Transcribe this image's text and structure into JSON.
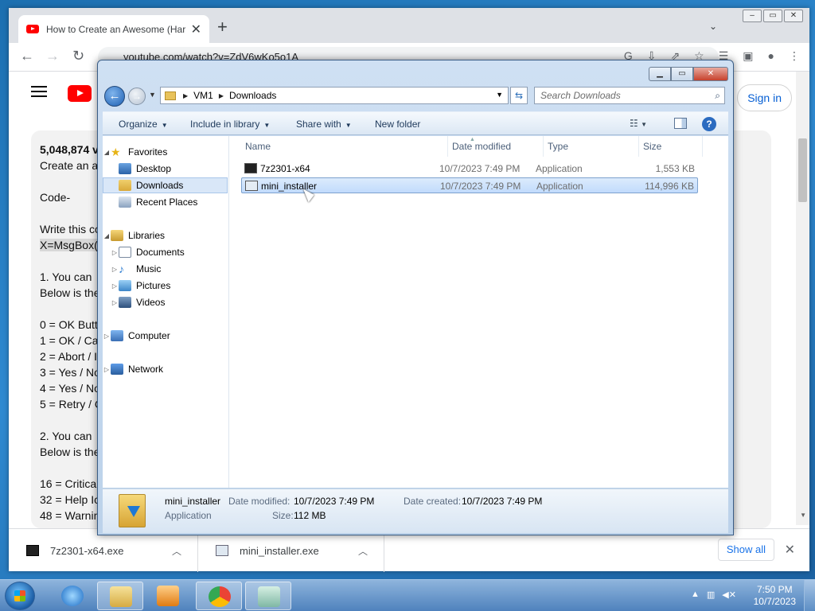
{
  "browser": {
    "tab_title": "How to Create an Awesome (Har",
    "address": "youtube.com/watch?v=ZdV6wKo5o1A",
    "signin_label": "Sign in",
    "new_tab": "+",
    "tab_close": "✕"
  },
  "description": {
    "views": "5,048,874 v",
    "lines": [
      "Create an a",
      "",
      "Code-",
      "",
      "Write this co",
      "X=MsgBox(",
      "",
      "1.  You can",
      "Below is the",
      "",
      "0 = OK Butto",
      "1 = OK / Ca",
      "2 = Abort / I",
      "3 = Yes / No",
      "4 = Yes / No",
      "5 = Retry / C",
      "",
      "2.  You can",
      "Below is the",
      "",
      "16 = Critica",
      "32 = Help Ic",
      "48 = Warnin"
    ]
  },
  "downloads_bar": {
    "items": [
      {
        "name": "7z2301-x64.exe"
      },
      {
        "name": "mini_installer.exe"
      }
    ],
    "show_all": "Show all"
  },
  "explorer": {
    "breadcrumb": [
      "VM1",
      "Downloads"
    ],
    "search_placeholder": "Search Downloads",
    "commands": {
      "organize": "Organize",
      "include_in_library": "Include in library",
      "share_with": "Share with",
      "new_folder": "New folder"
    },
    "nav": {
      "favorites": "Favorites",
      "desktop": "Desktop",
      "downloads": "Downloads",
      "recent_places": "Recent Places",
      "libraries": "Libraries",
      "documents": "Documents",
      "music": "Music",
      "pictures": "Pictures",
      "videos": "Videos",
      "computer": "Computer",
      "network": "Network"
    },
    "columns": {
      "name": "Name",
      "date_modified": "Date modified",
      "type": "Type",
      "size": "Size"
    },
    "files": [
      {
        "name": "7z2301-x64",
        "date": "10/7/2023 7:49 PM",
        "type": "Application",
        "size": "1,553 KB"
      },
      {
        "name": "mini_installer",
        "date": "10/7/2023 7:49 PM",
        "type": "Application",
        "size": "114,996 KB"
      }
    ],
    "details": {
      "name": "mini_installer",
      "type": "Application",
      "date_modified_label": "Date modified:",
      "date_modified": "10/7/2023 7:49 PM",
      "date_created_label": "Date created:",
      "date_created": "10/7/2023 7:49 PM",
      "size_label": "Size:",
      "size": "112 MB"
    }
  },
  "taskbar": {
    "time": "7:50 PM",
    "date": "10/7/2023"
  }
}
